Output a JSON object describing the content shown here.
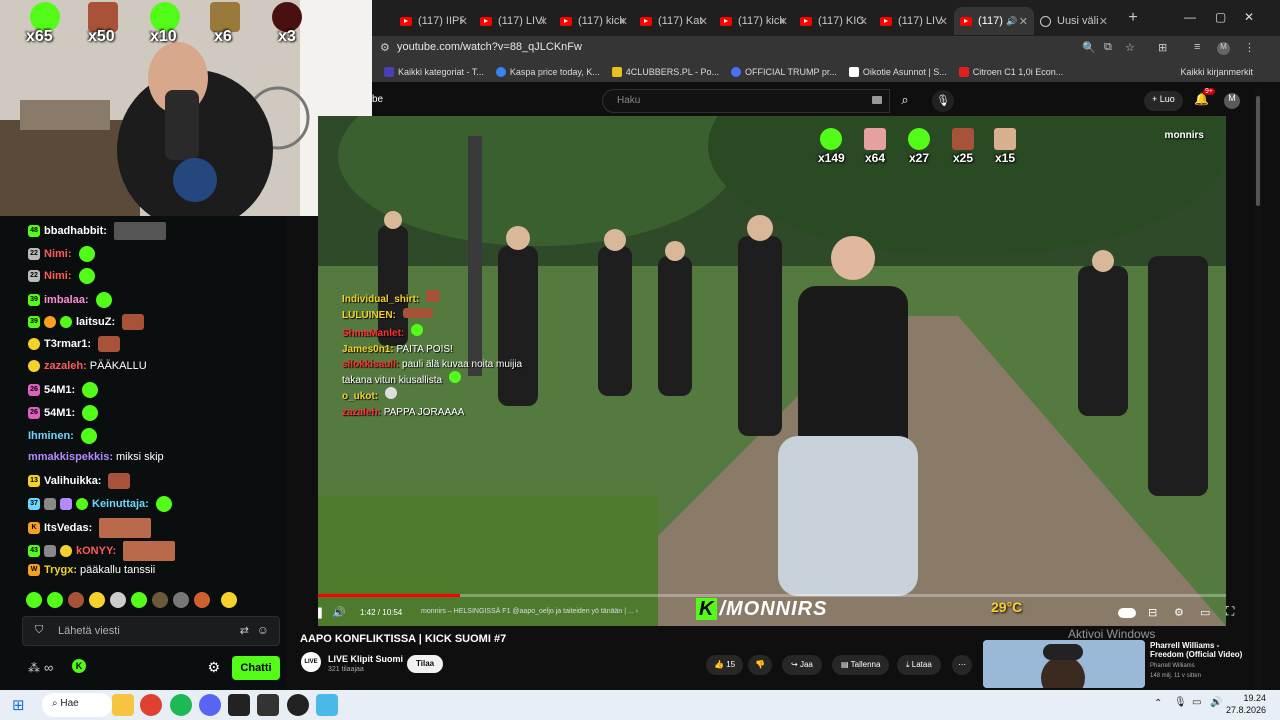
{
  "browser": {
    "tabs": [
      {
        "label": "(117) IIPF"
      },
      {
        "label": "(117) LIVI"
      },
      {
        "label": "(117) kick"
      },
      {
        "label": "(117) Kat"
      },
      {
        "label": "(117) kick"
      },
      {
        "label": "(117) KIC"
      },
      {
        "label": "(117) LIV"
      },
      {
        "label": "(117)"
      },
      {
        "label": "Uusi väli"
      }
    ],
    "url": "youtube.com/watch?v=88_qJLCKnFw",
    "bookmarks": [
      {
        "label": "Kaikki kategoriat - T...",
        "color": "#4a3fb5"
      },
      {
        "label": "Kaspa price today, K...",
        "color": "#3b82f6"
      },
      {
        "label": "4CLUBBERS.PL - Po...",
        "color": "#e8c020"
      },
      {
        "label": "OFFICIAL TRUMP pr...",
        "color": "#4a6ef5"
      },
      {
        "label": "Oikotie Asunnot | S...",
        "color": "#ffffff"
      },
      {
        "label": "Citroen C1 1,0i Econ...",
        "color": "#e02020"
      }
    ],
    "all_bookmarks": "Kaikki kirjanmerkit"
  },
  "youtube": {
    "logo_fragment": "be",
    "search_placeholder": "Haku",
    "create_label": "+ Luo",
    "notif_count": "9+",
    "avatar_letter": "M"
  },
  "webcam": {
    "counters": [
      "x65",
      "x50",
      "x10",
      "x6",
      "x3"
    ]
  },
  "video": {
    "counters": [
      "x149",
      "x64",
      "x27",
      "x25",
      "x15"
    ],
    "watermark": "monnirs",
    "brand": "/MONNIRS",
    "brand_k": "K",
    "temperature": "29°C",
    "time": "1:42 / 10:54",
    "chapter": "monnirs – HELSINGISSÄ F1 @aapo_oeljo ja taiteiden yö tänään | ... ›",
    "progress": 0.156,
    "overlay_chat": [
      {
        "user": "Individual_shirt:",
        "text": "",
        "color": "#f5d22a"
      },
      {
        "user": "LULUINEN:",
        "text": "",
        "color": "#f5d22a"
      },
      {
        "user": "ShmaManlet:",
        "text": "",
        "color": "#ff3030"
      },
      {
        "user": "James0n1:",
        "text": "PAITA POIS!",
        "color": "#f5d22a"
      },
      {
        "user": "silokkisauli:",
        "text": "pauli älä kuvaa noita muijia takana vitun kiusallista",
        "color": "#ff3030"
      },
      {
        "user": "o_ukot:",
        "text": "",
        "color": "#f5d22a"
      },
      {
        "user": "zazaleh:",
        "text": "PAPPA JORAAAA",
        "color": "#ff3030"
      }
    ]
  },
  "chat": {
    "messages": [
      {
        "user": "bbadhabbit:",
        "text": "",
        "color": "#ffffff",
        "badge": "48",
        "emote": "wide"
      },
      {
        "user": "Nimi:",
        "text": "",
        "color": "#ff5a5a",
        "badge": "22",
        "emote": "green"
      },
      {
        "user": "Nimi:",
        "text": "",
        "color": "#ff5a5a",
        "badge": "22",
        "emote": "green"
      },
      {
        "user": "imbalaa:",
        "text": "",
        "color": "#ff8ad8",
        "badge": "39",
        "emote": "green"
      },
      {
        "user": "laitsuZ:",
        "text": "",
        "color": "#ffffff",
        "badge": "39",
        "emote": "face"
      },
      {
        "user": "T3rmar1:",
        "text": "",
        "color": "#ffffff",
        "badge": "",
        "emote": "face"
      },
      {
        "user": "zazaleh:",
        "text": "PÄÄKALLU",
        "color": "#ff5a5a",
        "badge": "",
        "emote": ""
      },
      {
        "user": "54M1:",
        "text": "",
        "color": "#ffffff",
        "badge": "26",
        "emote": "green"
      },
      {
        "user": "54M1:",
        "text": "",
        "color": "#ffffff",
        "badge": "26",
        "emote": "green"
      },
      {
        "user": "Ihminen:",
        "text": "",
        "color": "#6ad8ff",
        "badge": "",
        "emote": "green"
      },
      {
        "user": "mmakkispekkis:",
        "text": "miksi skip",
        "color": "#b48aff",
        "badge": "",
        "emote": ""
      },
      {
        "user": "Valihuikka:",
        "text": "",
        "color": "#ffffff",
        "badge": "13",
        "emote": "face"
      },
      {
        "user": "Keinuttaja:",
        "text": "",
        "color": "#6ad8ff",
        "badge": "37",
        "emote": "green"
      },
      {
        "user": "ItsVedas:",
        "text": "",
        "color": "#ffffff",
        "badge": "K",
        "emote": "wide"
      },
      {
        "user": "kONYY:",
        "text": "",
        "color": "#ff5a5a",
        "badge": "43",
        "emote": "wide"
      },
      {
        "user": "Trygx:",
        "text": "pääkallu tanssii",
        "color": "#f5d22a",
        "badge": "W",
        "emote": ""
      }
    ],
    "input_placeholder": "Lähetä viesti",
    "send_label": "Chatti"
  },
  "below": {
    "title": "AAPO KONFLIKTISSA | KICK SUOMI #7",
    "channel": "LIVE Klipit Suomi",
    "channel_avatar": "LIVE",
    "subs": "321 tilaajaa",
    "subscribe": "Tilaa",
    "likes": "15",
    "share": "Jaa",
    "save": "Tallenna",
    "download": "Lataa",
    "activate_windows": "Aktivoi Windows",
    "rec_title": "Pharrell Williams - Freedom (Official Video)",
    "rec_channel": "Pharrell Williams",
    "rec_meta": "148 milj.  11 v sitten"
  },
  "taskbar": {
    "search": "Hae",
    "time": "19.24",
    "date": "27.8.2026"
  }
}
